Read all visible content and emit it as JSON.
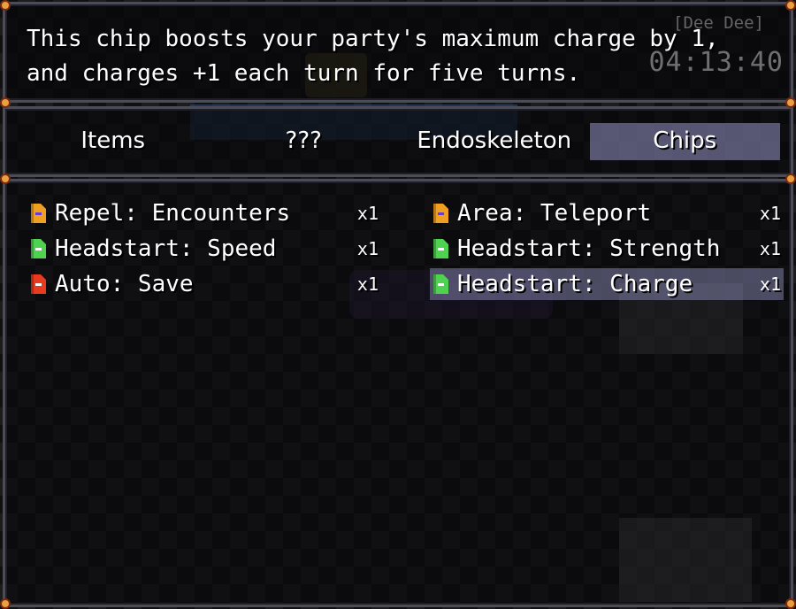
{
  "hud": {
    "player_name": "[Dee Dee]",
    "clock": "04:13:40"
  },
  "help": {
    "text": "This chip boosts your party's maximum charge by 1,\nand charges +1 each turn for five turns."
  },
  "tabs": [
    {
      "label": "Items"
    },
    {
      "label": "???"
    },
    {
      "label": "Endoskeleton"
    },
    {
      "label": "Chips",
      "selected": true
    }
  ],
  "items": [
    {
      "name": "Repel: Encounters",
      "qty": "x1",
      "chip_color": "#f0a020",
      "chip_mark": "#6a3ad0"
    },
    {
      "name": "Area: Teleport",
      "qty": "x1",
      "chip_color": "#f0a020",
      "chip_mark": "#6a3ad0"
    },
    {
      "name": "Headstart: Speed",
      "qty": "x1",
      "chip_color": "#4fd24f",
      "chip_mark": "#ffffff"
    },
    {
      "name": "Headstart: Strength",
      "qty": "x1",
      "chip_color": "#4fd24f",
      "chip_mark": "#ffffff"
    },
    {
      "name": "Auto: Save",
      "qty": "x1",
      "chip_color": "#e83a1e",
      "chip_mark": "#ffffff"
    },
    {
      "name": "Headstart: Charge",
      "qty": "x1",
      "chip_color": "#4fd24f",
      "chip_mark": "#ffffff",
      "selected": true
    }
  ],
  "colors": {
    "window_border": "#4c4c58",
    "selection": "#9696c8"
  }
}
